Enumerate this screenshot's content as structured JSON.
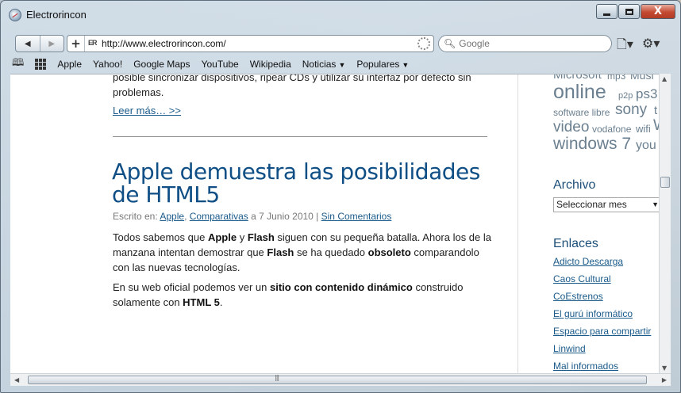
{
  "window": {
    "title": "Electrorincon",
    "minimize_label": "",
    "maximize_label": "",
    "close_label": "X"
  },
  "toolbar": {
    "back_icon": "back-arrow-icon",
    "forward_icon": "forward-arrow-icon",
    "add_icon": "plus-icon",
    "url": "http://www.electrorincon.com/",
    "favicon_text": "ER",
    "search_placeholder": "Google"
  },
  "bookmarks": {
    "items": [
      {
        "label": "Apple"
      },
      {
        "label": "Yahoo!"
      },
      {
        "label": "Google Maps"
      },
      {
        "label": "YouTube"
      },
      {
        "label": "Wikipedia"
      },
      {
        "label": "Noticias",
        "dropdown": true
      },
      {
        "label": "Populares",
        "dropdown": true
      }
    ]
  },
  "main": {
    "cut_text": "posible sincronizar dispositivos, ripear CDs y utilizar su interfaz por defecto sin problemas.",
    "read_more": "Leer más… >>",
    "post": {
      "title": "Apple demuestra las posibilidades de HTML5",
      "meta_prefix": "Escrito en: ",
      "category1": "Apple",
      "category_sep": ", ",
      "category2": "Comparativas",
      "date": " a 7 Junio 2010 | ",
      "comments": "Sin Comentarios",
      "p1": [
        {
          "t": "Todos sabemos que ",
          "b": false
        },
        {
          "t": "Apple",
          "b": true
        },
        {
          "t": " y ",
          "b": false
        },
        {
          "t": "Flash",
          "b": true
        },
        {
          "t": " siguen con su pequeña batalla. Ahora los de la manzana intentan demostrar que ",
          "b": false
        },
        {
          "t": "Flash",
          "b": true
        },
        {
          "t": " se ha quedado ",
          "b": false
        },
        {
          "t": "obsoleto",
          "b": true
        },
        {
          "t": " comparandolo con las nuevas tecnologías.",
          "b": false
        }
      ],
      "p2": [
        {
          "t": "En su web oficial podemos ver un ",
          "b": false
        },
        {
          "t": "sitio con contenido dinámico",
          "b": true
        },
        {
          "t": " construido solamente con ",
          "b": false
        },
        {
          "t": "HTML 5",
          "b": true
        },
        {
          "t": ".",
          "b": false
        }
      ]
    }
  },
  "sidebar": {
    "tags": [
      {
        "text": "Microsoft"
      },
      {
        "text": "mp3"
      },
      {
        "text": "Musi"
      },
      {
        "text": "online"
      },
      {
        "text": "p2p"
      },
      {
        "text": "ps3"
      },
      {
        "text": "software libre"
      },
      {
        "text": "sony"
      },
      {
        "text": "t"
      },
      {
        "text": "video"
      },
      {
        "text": "vodafone"
      },
      {
        "text": "wifi"
      },
      {
        "text": "W"
      },
      {
        "text": "windows 7"
      },
      {
        "text": "you"
      }
    ],
    "archive_heading": "Archivo",
    "archive_select": "Seleccionar mes",
    "links_heading": "Enlaces",
    "links": [
      {
        "label": "Adicto Descarga"
      },
      {
        "label": "Caos Cultural"
      },
      {
        "label": "CoEstrenos"
      },
      {
        "label": "El gurú informático"
      },
      {
        "label": "Espacio para compartir"
      },
      {
        "label": "Linwind"
      },
      {
        "label": "Mal informados"
      }
    ]
  }
}
